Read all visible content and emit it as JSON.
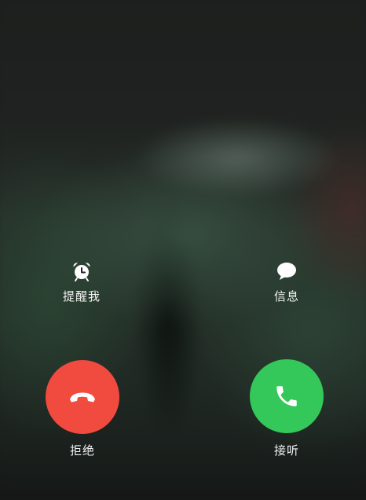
{
  "actions": {
    "remind": {
      "label": "提醒我",
      "icon": "alarm-clock-icon"
    },
    "message": {
      "label": "信息",
      "icon": "chat-bubble-icon"
    }
  },
  "call": {
    "decline": {
      "label": "拒绝",
      "icon": "phone-hangup-icon",
      "color": "#f14a3f"
    },
    "accept": {
      "label": "接听",
      "icon": "phone-icon",
      "color": "#34c759"
    }
  }
}
